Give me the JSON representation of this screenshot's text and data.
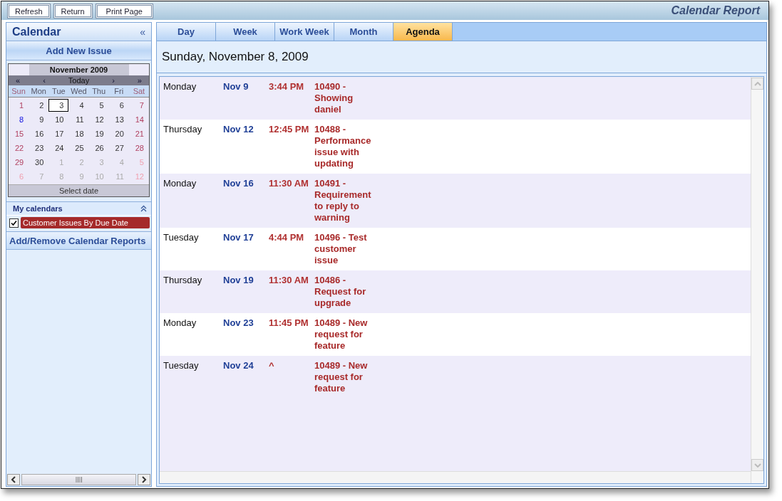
{
  "toolbar": {
    "buttons": [
      "Refresh",
      "Return",
      "Print Page"
    ],
    "title": "Calendar Report"
  },
  "sidebar": {
    "title": "Calendar",
    "collapse": "«",
    "add_button": "Add New Issue",
    "mini_calendar": {
      "month": "November 2009",
      "nav": [
        "«",
        "‹",
        "Today",
        "›",
        "»"
      ],
      "weekdays": [
        "Sun",
        "Mon",
        "Tue",
        "Wed",
        "Thu",
        "Fri",
        "Sat"
      ],
      "weeks": [
        [
          {
            "day": "1",
            "other_month": false,
            "selected": false,
            "marked": false
          },
          {
            "day": "2",
            "other_month": false,
            "selected": false,
            "marked": false
          },
          {
            "day": "3",
            "other_month": false,
            "selected": true,
            "marked": false
          },
          {
            "day": "4",
            "other_month": false,
            "selected": false,
            "marked": false
          },
          {
            "day": "5",
            "other_month": false,
            "selected": false,
            "marked": false
          },
          {
            "day": "6",
            "other_month": false,
            "selected": false,
            "marked": false
          },
          {
            "day": "7",
            "other_month": false,
            "selected": false,
            "marked": false
          }
        ],
        [
          {
            "day": "8",
            "other_month": false,
            "selected": false,
            "marked": true
          },
          {
            "day": "9",
            "other_month": false,
            "selected": false,
            "marked": false
          },
          {
            "day": "10",
            "other_month": false,
            "selected": false,
            "marked": false
          },
          {
            "day": "11",
            "other_month": false,
            "selected": false,
            "marked": false
          },
          {
            "day": "12",
            "other_month": false,
            "selected": false,
            "marked": false
          },
          {
            "day": "13",
            "other_month": false,
            "selected": false,
            "marked": false
          },
          {
            "day": "14",
            "other_month": false,
            "selected": false,
            "marked": false
          }
        ],
        [
          {
            "day": "15",
            "other_month": false,
            "selected": false,
            "marked": false
          },
          {
            "day": "16",
            "other_month": false,
            "selected": false,
            "marked": false
          },
          {
            "day": "17",
            "other_month": false,
            "selected": false,
            "marked": false
          },
          {
            "day": "18",
            "other_month": false,
            "selected": false,
            "marked": false
          },
          {
            "day": "19",
            "other_month": false,
            "selected": false,
            "marked": false
          },
          {
            "day": "20",
            "other_month": false,
            "selected": false,
            "marked": false
          },
          {
            "day": "21",
            "other_month": false,
            "selected": false,
            "marked": false
          }
        ],
        [
          {
            "day": "22",
            "other_month": false,
            "selected": false,
            "marked": false
          },
          {
            "day": "23",
            "other_month": false,
            "selected": false,
            "marked": false
          },
          {
            "day": "24",
            "other_month": false,
            "selected": false,
            "marked": false
          },
          {
            "day": "25",
            "other_month": false,
            "selected": false,
            "marked": false
          },
          {
            "day": "26",
            "other_month": false,
            "selected": false,
            "marked": false
          },
          {
            "day": "27",
            "other_month": false,
            "selected": false,
            "marked": false
          },
          {
            "day": "28",
            "other_month": false,
            "selected": false,
            "marked": false
          }
        ],
        [
          {
            "day": "29",
            "other_month": false,
            "selected": false,
            "marked": false
          },
          {
            "day": "30",
            "other_month": false,
            "selected": false,
            "marked": false
          },
          {
            "day": "1",
            "other_month": true,
            "selected": false,
            "marked": false
          },
          {
            "day": "2",
            "other_month": true,
            "selected": false,
            "marked": false
          },
          {
            "day": "3",
            "other_month": true,
            "selected": false,
            "marked": false
          },
          {
            "day": "4",
            "other_month": true,
            "selected": false,
            "marked": false
          },
          {
            "day": "5",
            "other_month": true,
            "selected": false,
            "marked": false
          }
        ],
        [
          {
            "day": "6",
            "other_month": true,
            "selected": false,
            "marked": false
          },
          {
            "day": "7",
            "other_month": true,
            "selected": false,
            "marked": false
          },
          {
            "day": "8",
            "other_month": true,
            "selected": false,
            "marked": false
          },
          {
            "day": "9",
            "other_month": true,
            "selected": false,
            "marked": false
          },
          {
            "day": "10",
            "other_month": true,
            "selected": false,
            "marked": false
          },
          {
            "day": "11",
            "other_month": true,
            "selected": false,
            "marked": false
          },
          {
            "day": "12",
            "other_month": true,
            "selected": false,
            "marked": false
          }
        ]
      ],
      "footer": "Select date"
    },
    "my_calendars": {
      "title": "My calendars",
      "items": [
        {
          "label": "Customer Issues By Due Date",
          "checked": true,
          "color": "#a52a2a"
        }
      ]
    },
    "add_remove": "Add/Remove Calendar Reports"
  },
  "tabs": [
    {
      "label": "Day",
      "selected": false
    },
    {
      "label": "Week",
      "selected": false
    },
    {
      "label": "Work Week",
      "selected": false
    },
    {
      "label": "Month",
      "selected": false
    },
    {
      "label": "Agenda",
      "selected": true
    }
  ],
  "date_heading": "Sunday, November 8, 2009",
  "agenda": [
    {
      "weekday": "Monday",
      "date": "Nov 9",
      "time": "3:44 PM",
      "title": "10490 - Showing daniel"
    },
    {
      "weekday": "Thursday",
      "date": "Nov 12",
      "time": "12:45 PM",
      "title": "10488 - Performance issue with updating"
    },
    {
      "weekday": "Monday",
      "date": "Nov 16",
      "time": "11:30 AM",
      "title": "10491 - Requirement to reply to warning"
    },
    {
      "weekday": "Tuesday",
      "date": "Nov 17",
      "time": "4:44 PM",
      "title": "10496 - Test customer issue"
    },
    {
      "weekday": "Thursday",
      "date": "Nov 19",
      "time": "11:30 AM",
      "title": "10486 - Request for upgrade"
    },
    {
      "weekday": "Monday",
      "date": "Nov 23",
      "time": "11:45 PM",
      "title": "10489 - New request for feature"
    },
    {
      "weekday": "Tuesday",
      "date": "Nov 24",
      "time": "^",
      "title": "10489 - New request for feature"
    }
  ]
}
